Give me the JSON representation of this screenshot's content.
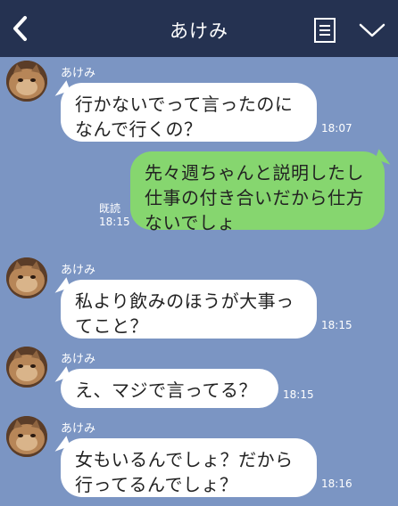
{
  "header": {
    "title": "あけみ",
    "back_icon": "chevron-left-icon",
    "menu_icon": "note-icon",
    "dropdown_icon": "chevron-down-icon"
  },
  "colors": {
    "background": "#7b95c3",
    "header": "#253251",
    "incoming_bubble": "#ffffff",
    "outgoing_bubble": "#86d66f"
  },
  "messages": [
    {
      "direction": "incoming",
      "sender": "あけみ",
      "text": "行かないでって言ったのに\nなんで行くの？",
      "time": "18:07"
    },
    {
      "direction": "outgoing",
      "read_label": "既読",
      "text": "先々週ちゃんと説明したし\n仕事の付き合いだから仕方\nないでしょ",
      "time": "18:15"
    },
    {
      "direction": "incoming",
      "sender": "あけみ",
      "text": "私より飲みのほうが大事っ\nてこと？",
      "time": "18:15"
    },
    {
      "direction": "incoming",
      "sender": "あけみ",
      "text": "え、マジで言ってる？",
      "time": "18:15"
    },
    {
      "direction": "incoming",
      "sender": "あけみ",
      "text": "女もいるんでしょ？だから\n行ってるんでしょ？",
      "time": "18:16"
    }
  ]
}
